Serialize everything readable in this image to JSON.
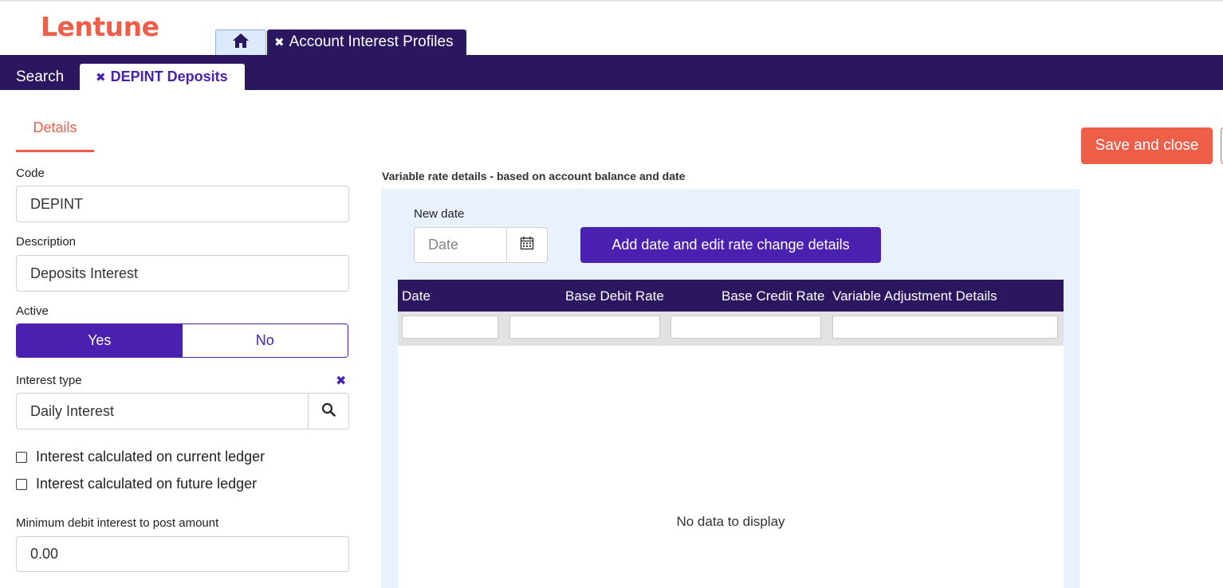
{
  "brand": {
    "logo_text": "Lentune",
    "accent_color": "#ee5e49",
    "primary_color": "#4a20b0",
    "nav_color": "#2b1760"
  },
  "app_tabs": {
    "home_icon": "home-icon",
    "active_tab_label": "Account Interest Profiles"
  },
  "subnav": {
    "search_label": "Search",
    "record_tab_label": "DEPINT Deposits"
  },
  "form_tabs": {
    "details_label": "Details"
  },
  "actions": {
    "save_close_label": "Save and close"
  },
  "form": {
    "code": {
      "label": "Code",
      "value": "DEPINT"
    },
    "description": {
      "label": "Description",
      "value": "Deposits Interest"
    },
    "active": {
      "label": "Active",
      "yes_label": "Yes",
      "no_label": "No",
      "selected": "Yes"
    },
    "interest_type": {
      "label": "Interest type",
      "value": "Daily Interest"
    },
    "current_ledger": {
      "label": "Interest calculated on current ledger",
      "checked": false
    },
    "future_ledger": {
      "label": "Interest calculated on future ledger",
      "checked": false
    },
    "min_debit": {
      "label": "Minimum debit interest to post amount",
      "value": "0.00"
    }
  },
  "variable_rates": {
    "title": "Variable rate details - based on account balance and date",
    "new_date_label": "New date",
    "date_placeholder": "Date",
    "add_button_label": "Add date and edit rate change details",
    "columns": [
      "Date",
      "Base Debit Rate",
      "Base Credit Rate",
      "Variable Adjustment Details"
    ],
    "rows": [],
    "empty_message": "No data to display"
  }
}
